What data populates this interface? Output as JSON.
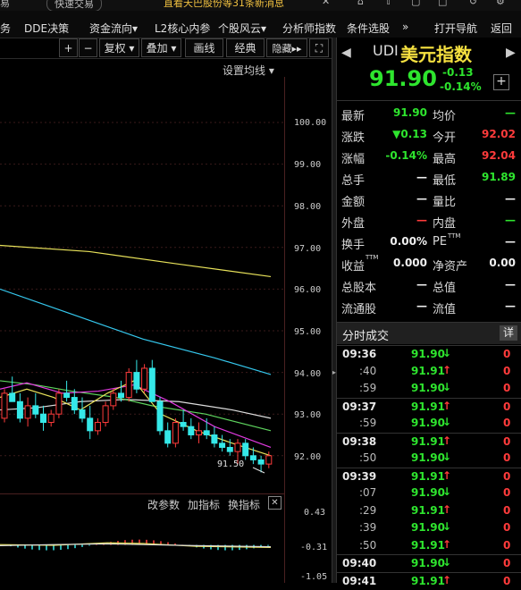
{
  "topbar": {
    "quick_trade": "快速交易",
    "news": "直看天巴股份等31条新消息"
  },
  "menu": {
    "items": [
      "务",
      "DDE决策",
      "资金流向▾",
      "L2核心内参",
      "个股风云▾",
      "分析师指数",
      "条件选股"
    ],
    "more": "»",
    "open_nav": "打开导航",
    "back": "返回"
  },
  "toolbar": {
    "plus": "+",
    "minus": "−",
    "fuquan": "复权",
    "diejia": "叠加",
    "huaxian": "画线",
    "jingdian": "经典",
    "yincang": "隐藏",
    "expand": "⛶",
    "set_ma": "设置均线"
  },
  "chart": {
    "price_axis": [
      "100.00",
      "99.00",
      "98.00",
      "97.00",
      "96.00",
      "95.00",
      "94.00",
      "93.00",
      "92.00"
    ],
    "low_marker": "91.50",
    "indicator_buttons": [
      "改参数",
      "加指标",
      "换指标"
    ],
    "indicator_axis": [
      "0.43",
      "-0.31",
      "-1.05"
    ],
    "colors": {
      "ma_yellow": "#e8e25a",
      "ma_cyan": "#35c8ee",
      "ma_magenta": "#e23ae0",
      "ma_green": "#5ed45e",
      "ma_white": "#dddddd",
      "up": "#ff3b3b",
      "down": "#35e8e8"
    }
  },
  "quote": {
    "code": "UDI",
    "name": "美元指数",
    "price": "91.90",
    "change": "-0.13",
    "change_pct": "-0.14%",
    "fields": [
      {
        "l1": "最新",
        "v1": "91.90",
        "c1": "green",
        "l2": "均价",
        "v2": "—",
        "c2": "green"
      },
      {
        "l1": "涨跌",
        "v1": "▼0.13",
        "c1": "green",
        "l2": "今开",
        "v2": "92.02",
        "c2": "red"
      },
      {
        "l1": "涨幅",
        "v1": "-0.14%",
        "c1": "green",
        "l2": "最高",
        "v2": "92.04",
        "c2": "red"
      },
      {
        "l1": "总手",
        "v1": "—",
        "c1": "white",
        "l2": "最低",
        "v2": "91.89",
        "c2": "green"
      },
      {
        "l1": "金额",
        "v1": "—",
        "c1": "white",
        "l2": "量比",
        "v2": "—",
        "c2": "white"
      },
      {
        "l1": "外盘",
        "v1": "—",
        "c1": "red",
        "l2": "内盘",
        "v2": "—",
        "c2": "green"
      },
      {
        "l1": "换手",
        "v1": "0.00%",
        "c1": "white",
        "l2": "PE",
        "v2": "—",
        "c2": "white"
      },
      {
        "l1": "收益",
        "v1": "0.000",
        "c1": "white",
        "l2": "净资产",
        "v2": "0.00",
        "c2": "white"
      },
      {
        "l1": "总股本",
        "v1": "—",
        "c1": "white",
        "l2": "总值",
        "v2": "—",
        "c2": "white"
      },
      {
        "l1": "流通股",
        "v1": "—",
        "c1": "white",
        "l2": "流值",
        "v2": "—",
        "c2": "white"
      }
    ],
    "ttm": "TTM"
  },
  "trades": {
    "title": "分时成交",
    "detail": "详",
    "rows": [
      {
        "time": "09:36",
        "sub": "",
        "price": "91.90",
        "dir": "down",
        "vol": "0"
      },
      {
        "time": "",
        "sub": ":40",
        "price": "91.91",
        "dir": "up",
        "vol": "0"
      },
      {
        "time": "",
        "sub": ":59",
        "price": "91.90",
        "dir": "down",
        "vol": "0"
      },
      {
        "time": "09:37",
        "sub": "",
        "price": "91.91",
        "dir": "up",
        "vol": "0"
      },
      {
        "time": "",
        "sub": ":59",
        "price": "91.90",
        "dir": "down",
        "vol": "0"
      },
      {
        "time": "09:38",
        "sub": "",
        "price": "91.91",
        "dir": "up",
        "vol": "0"
      },
      {
        "time": "",
        "sub": ":50",
        "price": "91.90",
        "dir": "down",
        "vol": "0"
      },
      {
        "time": "09:39",
        "sub": "",
        "price": "91.91",
        "dir": "up",
        "vol": "0"
      },
      {
        "time": "",
        "sub": ":07",
        "price": "91.90",
        "dir": "down",
        "vol": "0"
      },
      {
        "time": "",
        "sub": ":29",
        "price": "91.91",
        "dir": "up",
        "vol": "0"
      },
      {
        "time": "",
        "sub": ":39",
        "price": "91.90",
        "dir": "down",
        "vol": "0"
      },
      {
        "time": "",
        "sub": ":50",
        "price": "91.91",
        "dir": "up",
        "vol": "0"
      },
      {
        "time": "09:40",
        "sub": "",
        "price": "91.90",
        "dir": "down",
        "vol": "0"
      },
      {
        "time": "09:41",
        "sub": "",
        "price": "91.91",
        "dir": "up",
        "vol": "0"
      }
    ]
  }
}
